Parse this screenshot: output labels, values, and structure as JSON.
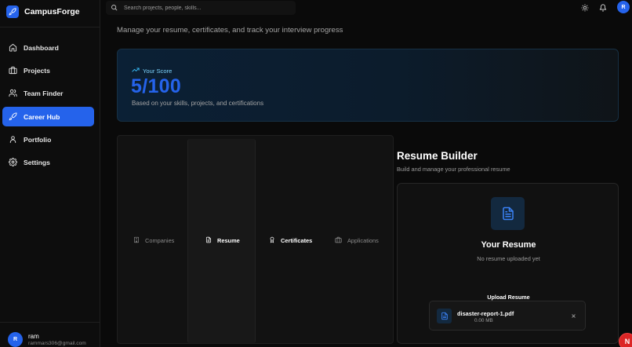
{
  "app": {
    "name": "CampusForge",
    "logo_icon": "rocket-icon",
    "accent_color": "#2563eb"
  },
  "sidebar": {
    "items": [
      {
        "label": "Dashboard",
        "icon": "home-icon",
        "active": false
      },
      {
        "label": "Projects",
        "icon": "folder-icon",
        "active": false
      },
      {
        "label": "Team Finder",
        "icon": "users-icon",
        "active": false
      },
      {
        "label": "Career Hub",
        "icon": "rocket-icon",
        "active": true
      },
      {
        "label": "Portfolio",
        "icon": "user-icon",
        "active": false
      },
      {
        "label": "Settings",
        "icon": "gear-icon",
        "active": false
      }
    ],
    "user": {
      "initial": "R",
      "name": "ram",
      "email": "rammars306@gmail.com"
    }
  },
  "topbar": {
    "search_placeholder": "Search projects, people, skills...",
    "avatar_initial": "R"
  },
  "page": {
    "subtitle": "Manage your resume, certificates, and track your interview progress"
  },
  "score": {
    "label": "Your Score",
    "value": "5/100",
    "description": "Based on your skills, projects, and certifications"
  },
  "tabs": [
    {
      "label": "Companies",
      "icon": "building-icon",
      "active": false
    },
    {
      "label": "Resume",
      "icon": "document-icon",
      "active": true
    },
    {
      "label": "Certificates",
      "icon": "award-icon",
      "active": false
    },
    {
      "label": "Applications",
      "icon": "briefcase-icon",
      "active": false
    }
  ],
  "resume_builder": {
    "title": "Resume Builder",
    "subtitle": "Build and manage your professional resume",
    "card_title": "Your Resume",
    "card_status": "No resume uploaded yet",
    "upload_title": "Upload Resume",
    "file": {
      "name": "disaster-report-1.pdf",
      "size": "0.00 MB"
    }
  },
  "floating_badge": {
    "initial": "N"
  }
}
